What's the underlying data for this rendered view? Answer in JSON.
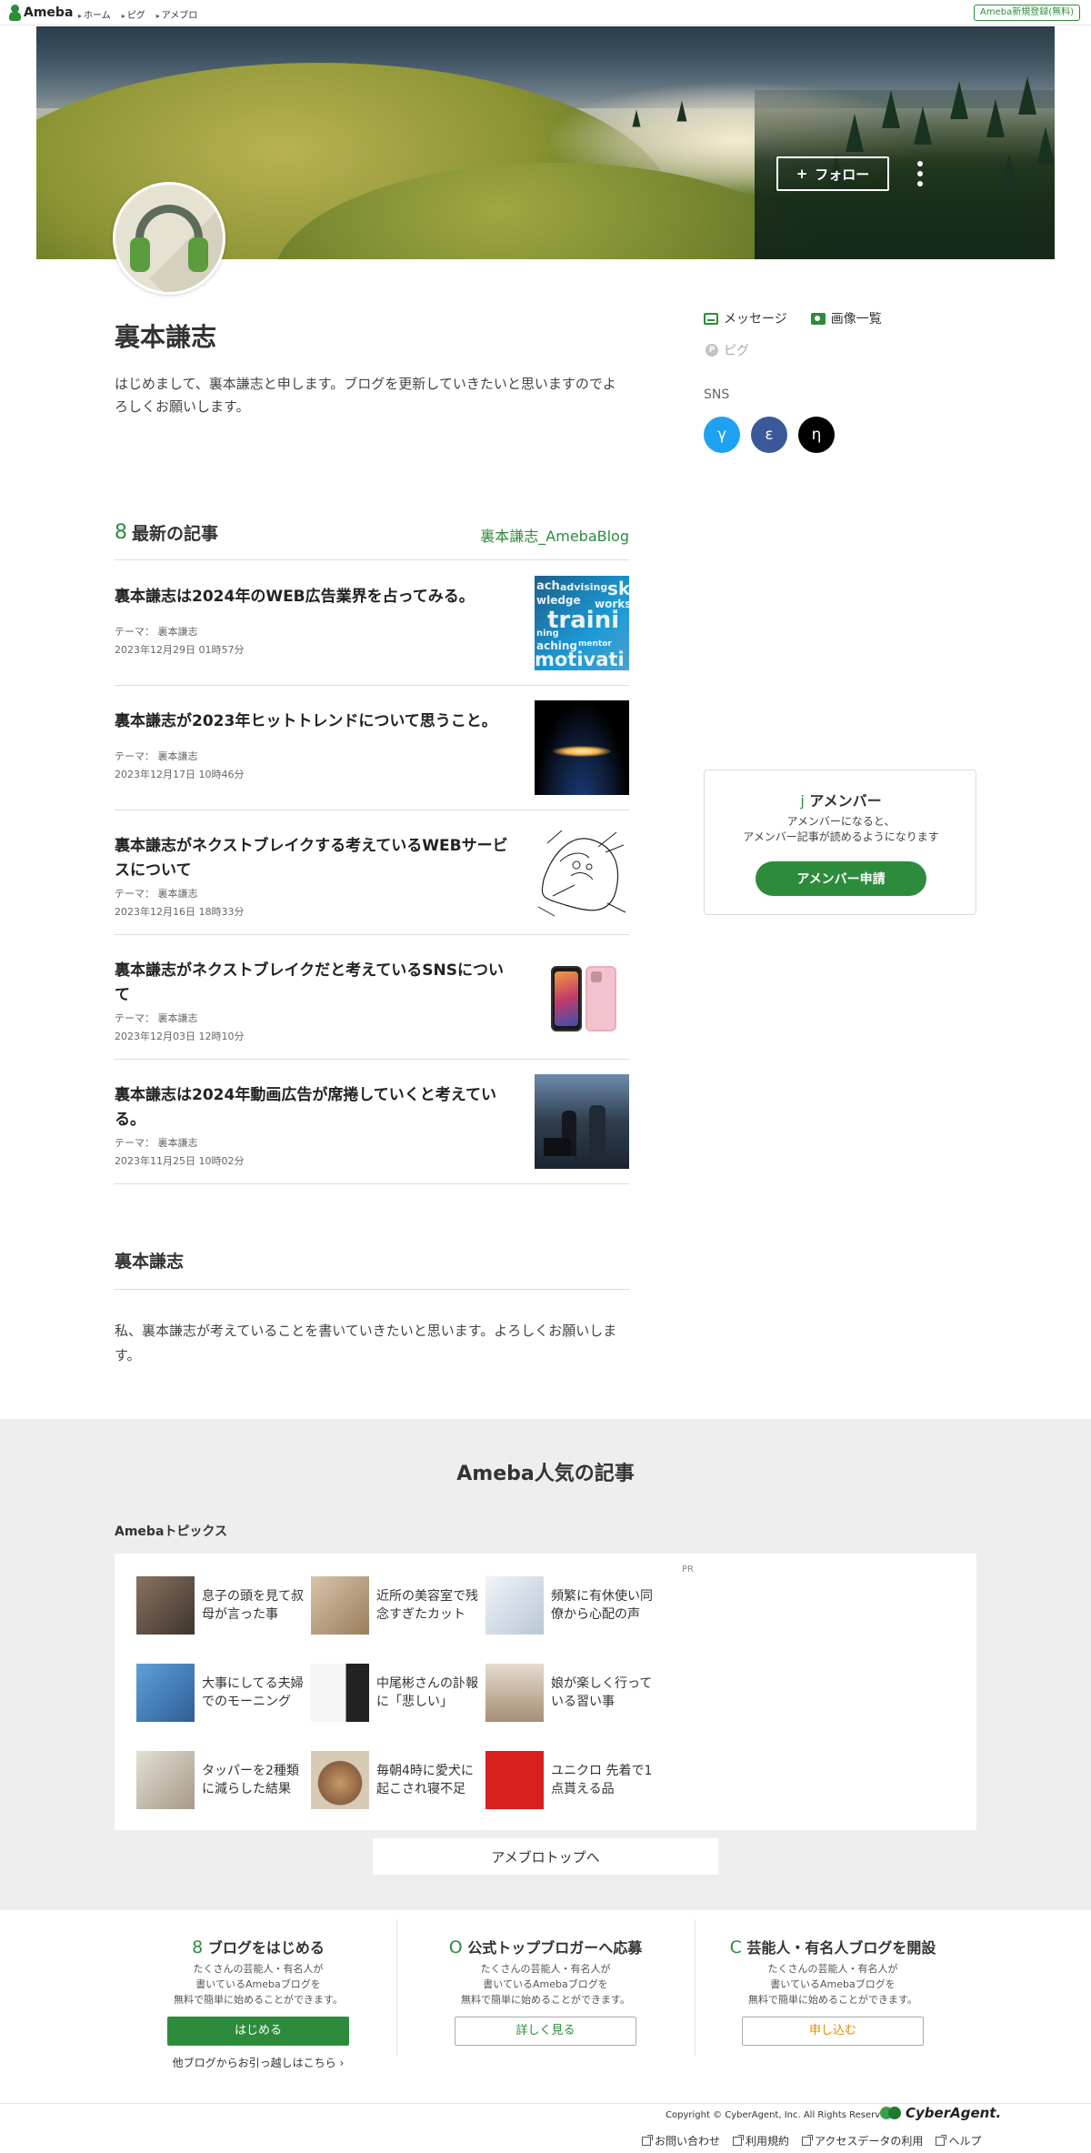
{
  "header": {
    "logo": "Ameba",
    "breadcrumbs": [
      "ホーム",
      "ピグ",
      "アメブロ"
    ],
    "register": "Ameba新規登録(無料)"
  },
  "hero": {
    "follow": "フォロー",
    "follow_icon": "plus-icon",
    "more_icon": "vertical-dots-icon"
  },
  "profile": {
    "name": "裏本謙志",
    "intro": "はじめまして、裏本謙志と申します。ブログを更新していきたいと思いますのでよろしくお願いします。",
    "links": {
      "message": "メッセージ",
      "images": "画像一覧",
      "pigg": "ピグ",
      "pigg_icon_letter": "P"
    },
    "sns_label": "SNS",
    "sns": [
      {
        "glyph": "γ",
        "color": "#1da1f2"
      },
      {
        "glyph": "ε",
        "color": "#3b5998"
      },
      {
        "glyph": "η",
        "color": "#000000"
      }
    ]
  },
  "latest": {
    "icon_glyph": "8",
    "title": "最新の記事",
    "blog_link": "裏本謙志_AmebaBlog",
    "articles": [
      {
        "title": "裏本謙志は2024年のWEB広告業界を占ってみる。",
        "theme": "テーマ： 裏本謙志",
        "date": "2023年12月29日 01時57分"
      },
      {
        "title": "裏本謙志が2023年ヒットトレンドについて思うこと。",
        "theme": "テーマ： 裏本謙志",
        "date": "2023年12月17日 10時46分"
      },
      {
        "title": "裏本謙志がネクストブレイクする考えているWEBサービスについて",
        "theme": "テーマ： 裏本謙志",
        "date": "2023年12月16日 18時33分"
      },
      {
        "title": "裏本謙志がネクストブレイクだと考えているSNSについて",
        "theme": "テーマ： 裏本謙志",
        "date": "2023年12月03日 12時10分"
      },
      {
        "title": "裏本謙志は2024年動画広告が席捲していくと考えている。",
        "theme": "テーマ： 裏本謙志",
        "date": "2023年11月25日 10時02分"
      }
    ],
    "thumb1_words": [
      "ach",
      "advising",
      "sk",
      "wledge",
      "works",
      "traini",
      "ning",
      "aching",
      "mentor",
      "motivati"
    ]
  },
  "member": {
    "icon_glyph": "j",
    "title": "アメンバー",
    "desc1": "アメンバーになると、",
    "desc2": "アメンバー記事が読めるようになります",
    "button": "アメンバー申請"
  },
  "blog_desc": {
    "title": "裏本謙志",
    "text": "私、裏本謙志が考えていることを書いていきたいと思います。よろしくお願いします。"
  },
  "popular": {
    "title": "Ameba人気の記事",
    "topics_label": "Amebaトピックス",
    "pr": "PR",
    "topics": [
      {
        "l1": "息子の頭を見て叔",
        "l2": "母が言った事",
        "color": "#7a6a5a"
      },
      {
        "l1": "近所の美容室で残",
        "l2": "念すぎたカット",
        "color": "#c9b49a"
      },
      {
        "l1": "頻繁に有休使い同",
        "l2": "僚から心配の声",
        "color": "#dfe7ef"
      },
      {
        "l1": "大事にしてる夫婦",
        "l2": "でのモーニング",
        "color": "#4a86c4"
      },
      {
        "l1": "中尾彬さんの訃報",
        "l2": "に「悲しい」",
        "color": "#f2f2f2"
      },
      {
        "l1": "娘が楽しく行って",
        "l2": "いる習い事",
        "color": "#c9b8a6"
      },
      {
        "l1": "タッパーを2種類",
        "l2": "に減らした結果",
        "color": "#d9d4cc"
      },
      {
        "l1": "毎朝4時に愛犬に",
        "l2": "起こされ寝不足",
        "color": "#b88a5c"
      },
      {
        "l1": "ユニクロ 先着で1",
        "l2": "点貰える品",
        "color": "#d8201f"
      }
    ],
    "top_button": "アメブロトップへ"
  },
  "ctas": [
    {
      "glyph": "8",
      "title": "ブログをはじめる",
      "d1": "たくさんの芸能人・有名人が",
      "d2": "書いているAmebaブログを",
      "d3": "無料で簡単に始めることができます。",
      "button": "はじめる",
      "sub": "他ブログからお引っ越しはこちら"
    },
    {
      "glyph": "O",
      "title": "公式トップブロガーへ応募",
      "d1": "たくさんの芸能人・有名人が",
      "d2": "書いているAmebaブログを",
      "d3": "無料で簡単に始めることができます。",
      "button": "詳しく見る"
    },
    {
      "glyph": "C",
      "title": "芸能人・有名人ブログを開設",
      "d1": "たくさんの芸能人・有名人が",
      "d2": "書いているAmebaブログを",
      "d3": "無料で簡単に始めることができます。",
      "button": "申し込む"
    }
  ],
  "footer": {
    "copyright": "Copyright © CyberAgent, Inc. All Rights Reserved.",
    "company": "CyberAgent.",
    "links": [
      "お問い合わせ",
      "利用規約",
      "アクセスデータの利用",
      "ヘルプ"
    ]
  },
  "colors": {
    "accent": "#2d8c3c",
    "popular_bg": "#eeeeee",
    "apply_orange": "#e08a00"
  }
}
